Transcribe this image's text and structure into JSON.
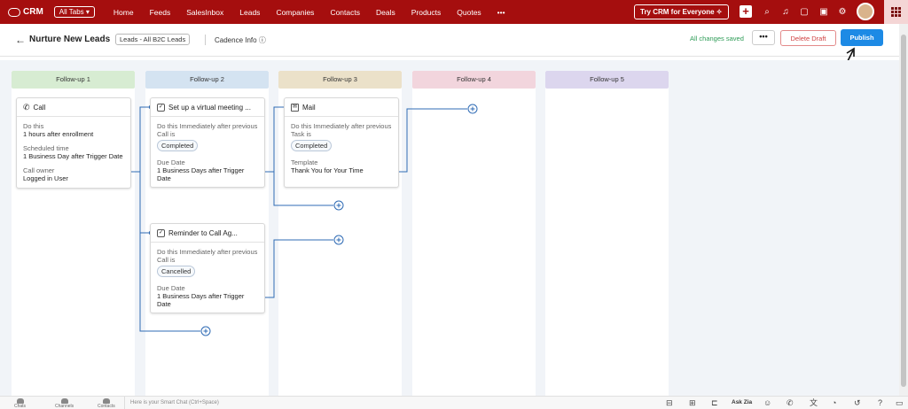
{
  "app": {
    "name": "CRM",
    "all_tabs": "All Tabs ▾",
    "try_button": "Try CRM for Everyone ✧"
  },
  "nav": [
    "Home",
    "Feeds",
    "SalesInbox",
    "Leads",
    "Companies",
    "Contacts",
    "Deals",
    "Products",
    "Quotes",
    "•••"
  ],
  "header": {
    "back_icon": "←",
    "title": "Nurture New Leads",
    "view_pill": "Leads - All B2C Leads",
    "cadence_info": "Cadence Info ⓘ",
    "save_status": "All changes saved",
    "more_label": "•••",
    "delete_label": "Delete Draft",
    "publish_label": "Publish"
  },
  "columns": [
    {
      "label": "Follow-up 1",
      "color": "#d7ecd2"
    },
    {
      "label": "Follow-up 2",
      "color": "#d4e3f1"
    },
    {
      "label": "Follow-up 3",
      "color": "#ebe1c9"
    },
    {
      "label": "Follow-up 4",
      "color": "#f2d5dd"
    },
    {
      "label": "Follow-up 5",
      "color": "#dcd6ee"
    }
  ],
  "cards": {
    "call": {
      "icon": "phone-icon",
      "title": "Call",
      "do_label": "Do this",
      "do_value": "1 hours after enrollment",
      "sched_label": "Scheduled time",
      "sched_value": "1 Business Day after Trigger Date",
      "owner_label": "Call owner",
      "owner_value": "Logged in User"
    },
    "meeting": {
      "icon": "task-icon",
      "title": "Set up a virtual meeting ...",
      "do_label": "Do this Immediately after previous Call is",
      "status": "Completed",
      "due_label": "Due Date",
      "due_value": "1 Business Days after Trigger Date"
    },
    "mail": {
      "icon": "mail-icon",
      "title": "Mail",
      "do_label": "Do this Immediately after previous Task is",
      "status": "Completed",
      "template_label": "Template",
      "template_value": "Thank You for Your Time"
    },
    "reminder": {
      "icon": "task-icon",
      "title": "Reminder to Call Ag...",
      "do_label": "Do this Immediately after previous Call is",
      "status": "Cancelled",
      "due_label": "Due Date",
      "due_value": "1 Business Days after Trigger Date"
    }
  },
  "bottombar": {
    "chats": "Chats",
    "channels": "Channels",
    "contacts": "Contacts",
    "smart_chat": "Here is your Smart Chat (Ctrl+Space)",
    "ask_zia": "Ask Zia"
  },
  "colors": {
    "brand": "#a50e0e",
    "publish": "#1d8ae5",
    "delete": "#d04343",
    "saved": "#2e9c57"
  }
}
